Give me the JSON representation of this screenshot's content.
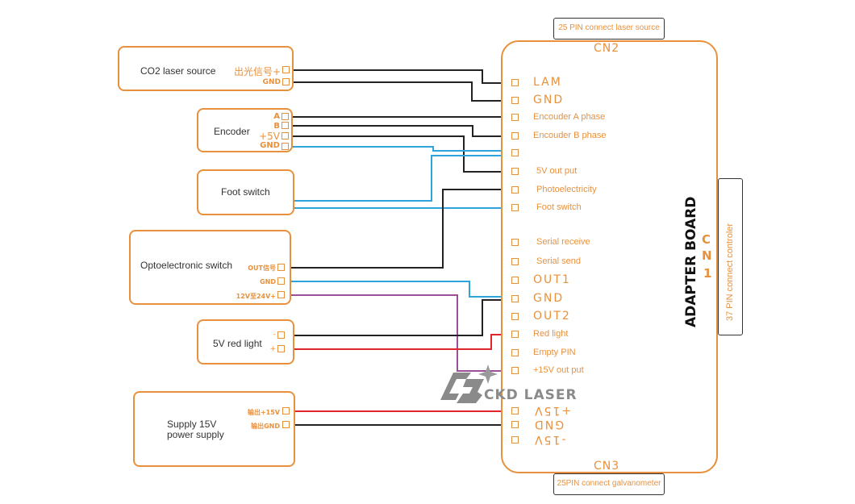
{
  "devices": {
    "co2_laser": {
      "title": "CO2 laser source",
      "pins": [
        "出光信号+",
        "GND"
      ]
    },
    "encoder": {
      "title": "Encoder",
      "pins": [
        "A",
        "B",
        "+5V",
        "GND"
      ]
    },
    "foot_switch": {
      "title": "Foot switch"
    },
    "opto_switch": {
      "title": "Optoelectronic switch",
      "pins": [
        "OUT信号",
        "GND",
        "12V至24V+"
      ]
    },
    "red_light": {
      "title": "5V red light",
      "pins": [
        "-",
        "+"
      ]
    },
    "power_supply": {
      "title_line1": "Supply 15V",
      "title_line2": "power supply",
      "pins": [
        "输出+15V",
        "输出GND"
      ]
    }
  },
  "board": {
    "title": "ADAPTER BOARD",
    "cn2": {
      "label": "CN2",
      "tag": "25 PIN connect laser source"
    },
    "cn1": {
      "label_c": "C",
      "label_n": "N",
      "label_1": "1",
      "tag": "37 PIN connect controler"
    },
    "cn3": {
      "label": "CN3",
      "tag": "25PIN connect galvanometer"
    },
    "pins": [
      "LAM",
      "GND",
      "Encouder A phase",
      "Encouder B phase",
      "",
      "5V out put",
      "Photoelectricity",
      "Foot switch",
      "Serial receive",
      "Serial send",
      "OUT1",
      "GND",
      "OUT2",
      "Red light",
      "Empty PIN",
      "+15V out put",
      "+15V",
      "GND",
      "-15V"
    ]
  },
  "watermark": {
    "text": "CKD LASER"
  },
  "colors": {
    "accent": "#e8913d",
    "wire_black": "#222222",
    "wire_blue": "#2fa3dc",
    "wire_red": "#e0262b",
    "wire_purple": "#9b4f96",
    "watermark": "#8a8a8a"
  }
}
